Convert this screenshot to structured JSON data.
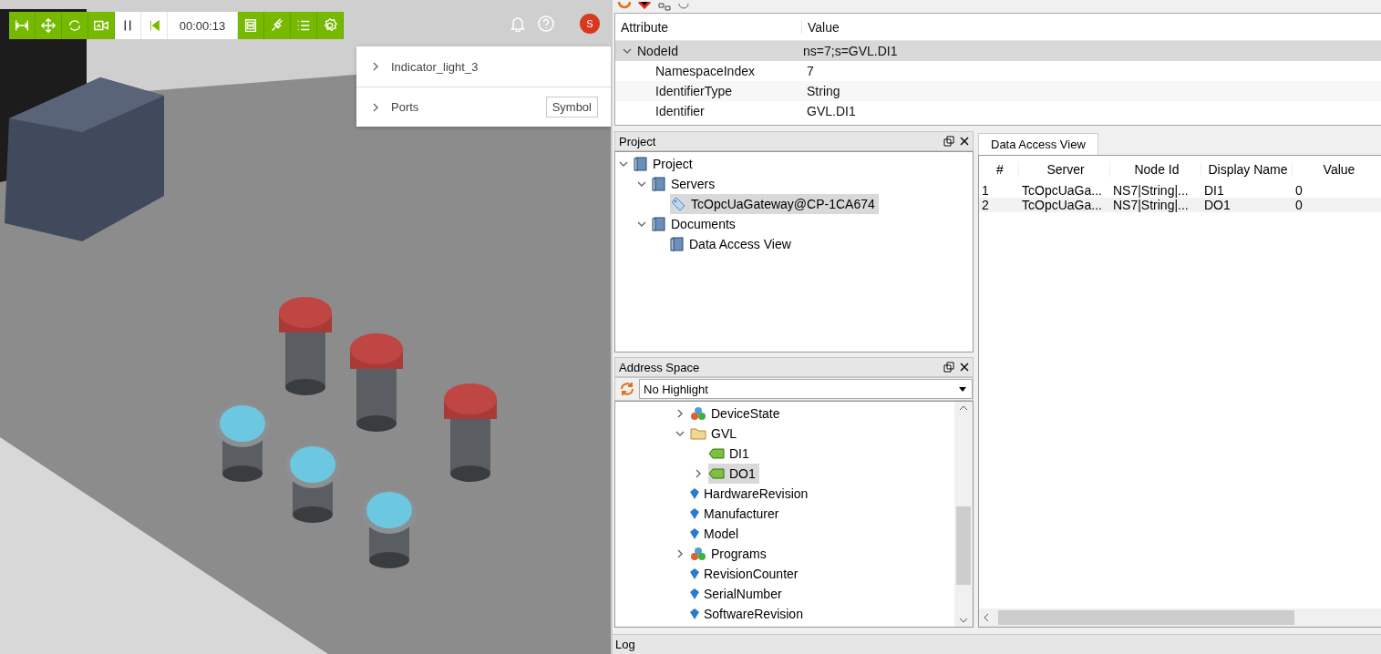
{
  "viewport": {
    "toolbar": [
      {
        "kind": "tool"
      },
      {
        "kind": "tool"
      },
      {
        "kind": "tool"
      },
      {
        "kind": "tool"
      },
      {
        "kind": "control"
      },
      {
        "kind": "control"
      },
      {
        "kind": "time",
        "text": "00:00:13"
      },
      {
        "kind": "tool"
      },
      {
        "kind": "tool"
      },
      {
        "kind": "tool"
      },
      {
        "kind": "tool"
      }
    ],
    "avatar": "S",
    "panel": [
      {
        "label": "Indicator_light_3",
        "expanded": false
      },
      {
        "label": "Ports",
        "expanded": false,
        "button": "Symbol"
      }
    ]
  },
  "attributes": {
    "columns": [
      "Attribute",
      "Value"
    ],
    "rows": [
      {
        "name": "NodeId",
        "value": "ns=7;s=GVL.DI1",
        "expanded": true,
        "selected": true,
        "children": [
          {
            "name": "NamespaceIndex",
            "value": "7",
            "selected": false
          },
          {
            "name": "IdentifierType",
            "value": "String",
            "selected": false
          },
          {
            "name": "Identifier",
            "value": "GVL.DI1",
            "selected": false
          }
        ]
      }
    ]
  },
  "project": {
    "title": "Project",
    "tree": [
      {
        "label": "Project",
        "kind": "folder",
        "expanded": true,
        "selected": false,
        "children": [
          {
            "label": "Servers",
            "kind": "folder",
            "expanded": true,
            "selected": false,
            "children": [
              {
                "label": "TcOpcUaGateway@CP-1CA674",
                "kind": "server",
                "selected": true
              }
            ]
          },
          {
            "label": "Documents",
            "kind": "folder",
            "expanded": true,
            "selected": false,
            "children": [
              {
                "label": "Data Access View",
                "kind": "folder",
                "selected": false
              }
            ]
          }
        ]
      }
    ]
  },
  "address_space": {
    "title": "Address Space",
    "filter": "No Highlight",
    "tree": [
      {
        "label": "DeviceState",
        "kind": "object",
        "expanded": false,
        "selected": false
      },
      {
        "label": "GVL",
        "kind": "folder",
        "expanded": true,
        "selected": false,
        "children": [
          {
            "label": "DI1",
            "kind": "variable",
            "selected": false
          },
          {
            "label": "DO1",
            "kind": "variable",
            "expanded": false,
            "selected": true
          }
        ]
      },
      {
        "label": "HardwareRevision",
        "kind": "property",
        "selected": false
      },
      {
        "label": "Manufacturer",
        "kind": "property",
        "selected": false
      },
      {
        "label": "Model",
        "kind": "property",
        "selected": false
      },
      {
        "label": "Programs",
        "kind": "object",
        "expanded": false,
        "selected": false
      },
      {
        "label": "RevisionCounter",
        "kind": "property",
        "selected": false
      },
      {
        "label": "SerialNumber",
        "kind": "property",
        "selected": false
      },
      {
        "label": "SoftwareRevision",
        "kind": "property",
        "selected": false
      }
    ]
  },
  "data_access": {
    "tab": "Data Access View",
    "columns": [
      "#",
      "Server",
      "Node Id",
      "Display Name",
      "Value"
    ],
    "rows": [
      [
        "1",
        "TcOpcUaGa...",
        "NS7|String|...",
        "DI1",
        "0"
      ],
      [
        "2",
        "TcOpcUaGa...",
        "NS7|String|...",
        "DO1",
        "0"
      ]
    ]
  },
  "log": {
    "title": "Log"
  }
}
